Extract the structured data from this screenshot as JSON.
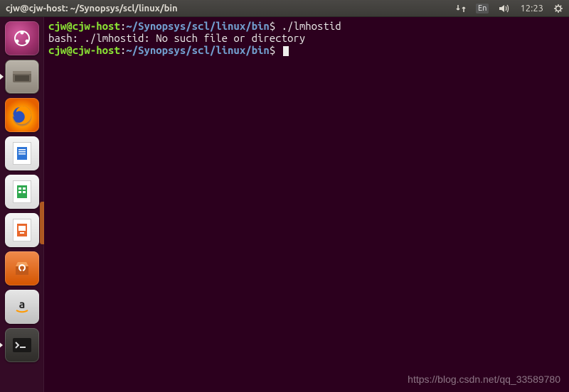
{
  "menubar": {
    "title": "cjw@cjw-host: ~/Synopsys/scl/linux/bin",
    "lang": "En",
    "time": "12:23"
  },
  "launcher": {
    "dash": "Dash",
    "files": "Files",
    "firefox": "Firefox",
    "writer": "LibreOffice Writer",
    "calc": "LibreOffice Calc",
    "impress": "LibreOffice Impress",
    "software": "Ubuntu Software",
    "amazon": "Amazon",
    "terminal": "Terminal"
  },
  "terminal": {
    "line1_userhost": "cjw@cjw-host",
    "line1_colon": ":",
    "line1_path": "~/Synopsys/scl/linux/bin",
    "line1_prompt": "$",
    "line1_cmd": "./lmhostid",
    "line2": "bash: ./lmhostid: No such file or directory",
    "line3_userhost": "cjw@cjw-host",
    "line3_colon": ":",
    "line3_path": "~/Synopsys/scl/linux/bin",
    "line3_prompt": "$"
  },
  "watermark": "https://blog.csdn.net/qq_33589780"
}
